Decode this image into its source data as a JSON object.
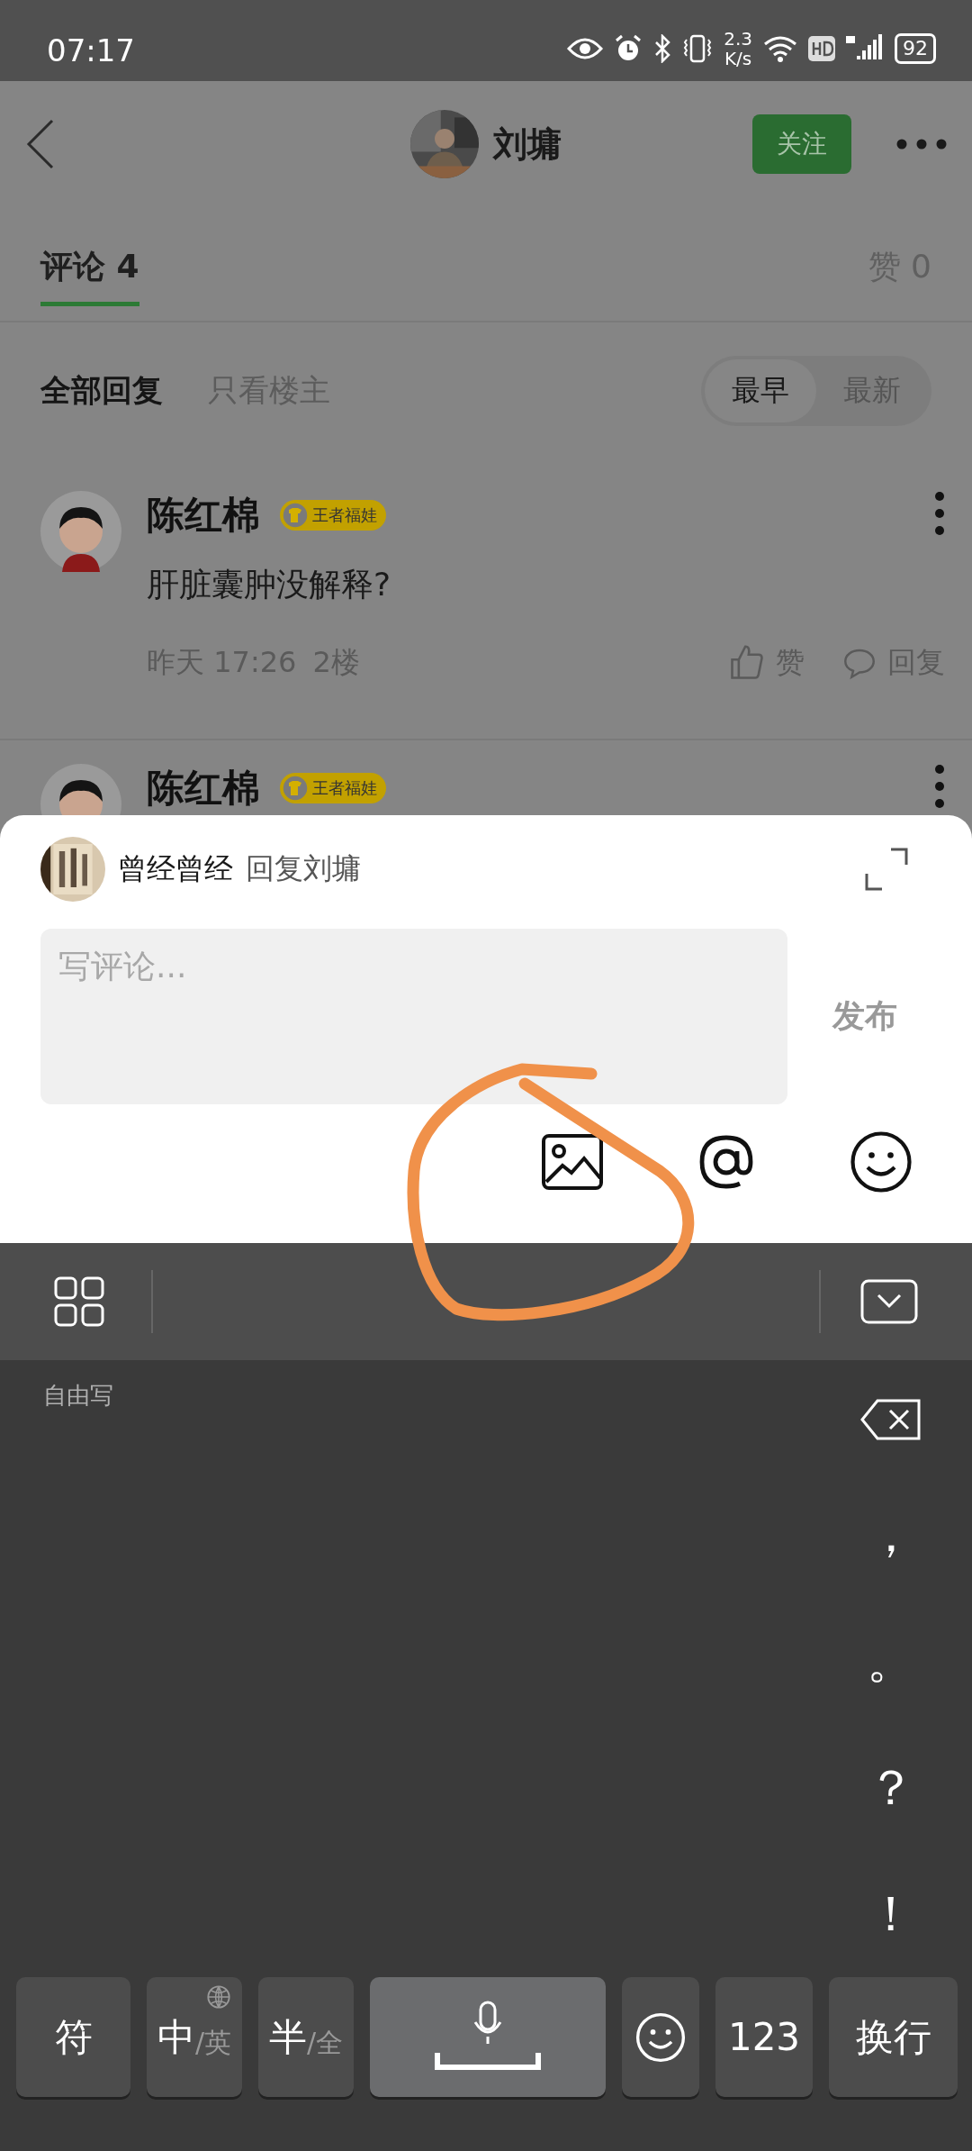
{
  "status_bar": {
    "time": "07:17",
    "speed_value": "2.3",
    "speed_unit": "K/s",
    "battery": "92"
  },
  "header": {
    "name": "刘墉",
    "follow_button": "关注"
  },
  "tabs": [
    {
      "label": "评论 4",
      "selected": true
    },
    {
      "label": "赞 0",
      "selected": false
    }
  ],
  "filters": [
    {
      "label": "全部回复",
      "selected": true
    },
    {
      "label": "只看楼主",
      "selected": false
    }
  ],
  "sort": [
    {
      "label": "最早",
      "selected": true
    },
    {
      "label": "最新",
      "selected": false
    }
  ],
  "comments": [
    {
      "name": "陈红棉",
      "badge": "王者福娃",
      "text": "肝脏囊肿没解释?",
      "time": "昨天 17:26",
      "floor": "2楼",
      "like": "赞",
      "reply": "回复"
    },
    {
      "name": "陈红棉",
      "badge": "王者福娃"
    }
  ],
  "reply_sheet": {
    "user": "曾经曾经",
    "reply_to": "回复刘墉",
    "placeholder": "写评论...",
    "publish": "发布"
  },
  "keyboard": {
    "mode_label": "自由写",
    "punctuation": [
      "，",
      "。",
      "？",
      "！"
    ],
    "keys": [
      {
        "kind": "text",
        "label": "符"
      },
      {
        "kind": "toggle",
        "main": "中",
        "alt": "/英",
        "globe": true
      },
      {
        "kind": "toggle",
        "main": "半",
        "alt": "/全",
        "globe": false
      },
      {
        "kind": "space"
      },
      {
        "kind": "emoji"
      },
      {
        "kind": "text",
        "label": "123"
      },
      {
        "kind": "text",
        "label": "换行"
      }
    ]
  },
  "annotation": {
    "kind": "loop"
  }
}
